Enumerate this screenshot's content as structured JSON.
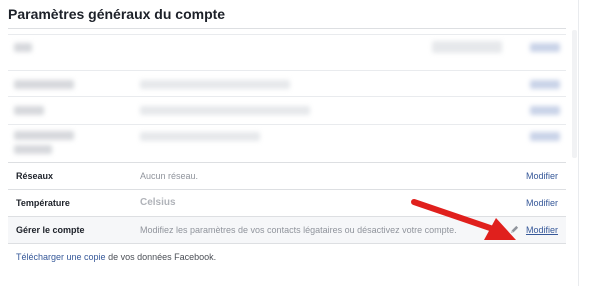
{
  "page": {
    "title": "Paramètres généraux du compte"
  },
  "rows": [
    {
      "label": "Réseaux",
      "value": "Aucun réseau.",
      "action": "Modifier"
    },
    {
      "label": "Température",
      "value": "Celsius",
      "action": "Modifier"
    },
    {
      "label": "Gérer le compte",
      "value": "Modifiez les paramètres de vos contacts légataires ou désactivez votre compte.",
      "action": "Modifier"
    }
  ],
  "footer": {
    "link": "Télécharger une copie",
    "text": " de vos données Facebook."
  },
  "icons": {
    "edit": "pencil-icon",
    "annotation": "red-arrow-icon"
  },
  "colors": {
    "link": "#365899",
    "arrow": "#e0201d",
    "highlight_row": "#f6f7f9"
  }
}
